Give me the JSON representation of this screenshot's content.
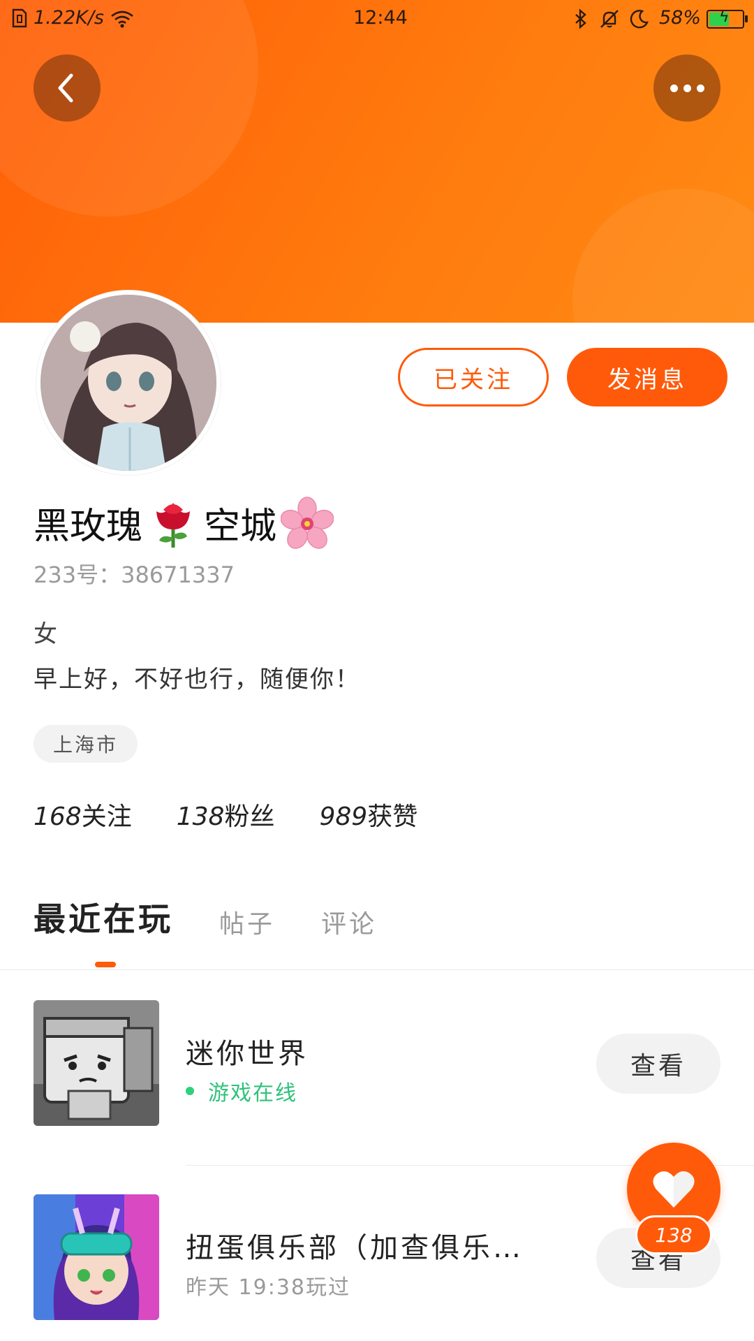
{
  "status_bar": {
    "net_speed": "1.22K/s",
    "time": "12:44",
    "battery": "58%",
    "battery_level": 0.58
  },
  "header": {
    "back_icon": "chevron-left-icon",
    "more_icon": "more-dots-icon"
  },
  "profile": {
    "nickname_part1": "黑玫瑰",
    "emoji1": "rose-emoji",
    "nickname_part2": "空城",
    "emoji2": "cherry-blossom-emoji",
    "account_id": "233号：38671337",
    "gender": "女",
    "bio": "早上好，不好也行，随便你！",
    "location": "上海市"
  },
  "actions": {
    "following_label": "已关注",
    "message_label": "发消息"
  },
  "stats": [
    {
      "num": "168",
      "label": "关注"
    },
    {
      "num": "138",
      "label": "粉丝"
    },
    {
      "num": "989",
      "label": "获赞"
    }
  ],
  "tabs": [
    {
      "label": "最近在玩",
      "active": true
    },
    {
      "label": "帖子",
      "active": false
    },
    {
      "label": "评论",
      "active": false
    }
  ],
  "games": [
    {
      "title": "迷你世界",
      "status": "游戏在线",
      "status_color": "#2ec27a",
      "button": "查看"
    },
    {
      "title": "扭蛋俱乐部（加查俱乐…",
      "status": "昨天 19:38玩过",
      "status_color": "#9a9a9a",
      "button": "查看"
    }
  ],
  "like": {
    "count": "138",
    "icon": "heart-icon"
  },
  "colors": {
    "accent": "#ff5a0a",
    "online": "#2ec27a"
  }
}
